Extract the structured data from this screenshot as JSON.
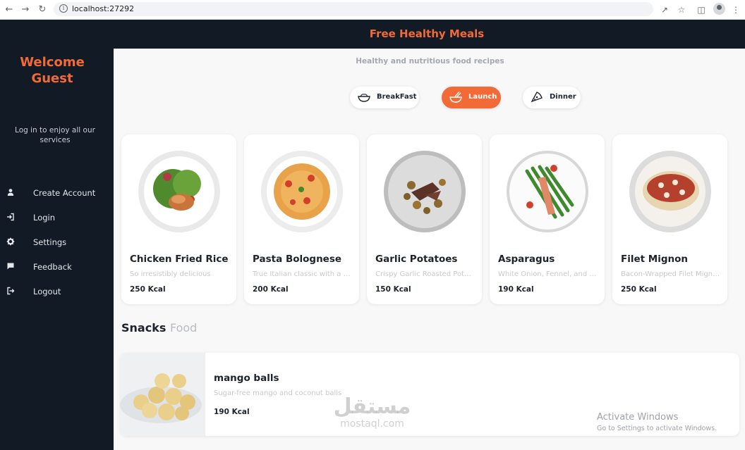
{
  "browser": {
    "url": "localhost:27292",
    "back_icon": "back-arrow-icon",
    "forward_icon": "forward-arrow-icon",
    "reload_icon": "reload-icon"
  },
  "header": {
    "title": "Free Healthy Meals"
  },
  "sidebar": {
    "welcome": "Welcome Guest",
    "login_hint": "Log in to enjoy all our services",
    "items": [
      {
        "label": "Create Account",
        "icon": "user-icon"
      },
      {
        "label": "Login",
        "icon": "login-icon"
      },
      {
        "label": "Settings",
        "icon": "gear-icon"
      },
      {
        "label": "Feedback",
        "icon": "feedback-icon"
      },
      {
        "label": "Logout",
        "icon": "logout-icon"
      }
    ]
  },
  "main": {
    "subtitle": "Healthy and nutritious food recipes",
    "tabs": [
      {
        "label": "BreakFast",
        "active": false
      },
      {
        "label": "Launch",
        "active": true
      },
      {
        "label": "Dinner",
        "active": false
      }
    ],
    "meals": [
      {
        "name": "Chicken Fried Rice",
        "desc": "So irresistibly delicious",
        "kcal": "250 Kcal"
      },
      {
        "name": "Pasta Bolognese",
        "desc": "True Italian classic with a meaty, chilli sauce",
        "kcal": "200 Kcal"
      },
      {
        "name": "Garlic Potatoes",
        "desc": "Crispy Garlic Roasted Potatoes",
        "kcal": "150 Kcal"
      },
      {
        "name": "Asparagus",
        "desc": "White Onion, Fennel, and Asparagus",
        "kcal": "190 Kcal"
      },
      {
        "name": "Filet Mignon",
        "desc": "Bacon-Wrapped Filet Mignon",
        "kcal": "250 Kcal"
      }
    ],
    "snacks_title": "Snacks",
    "snacks_title_muted": "Food",
    "snacks": [
      {
        "name": "mango balls",
        "desc": "Sugar-free mango and coconut balls",
        "kcal": "190 Kcal"
      }
    ]
  },
  "overlay": {
    "activate_title": "Activate Windows",
    "activate_sub": "Go to Settings to activate Windows.",
    "watermark_ar": "مستقل",
    "watermark_en": "mostaql.com"
  },
  "colors": {
    "accent": "#f26a36",
    "sidebar_bg": "#121a26"
  }
}
